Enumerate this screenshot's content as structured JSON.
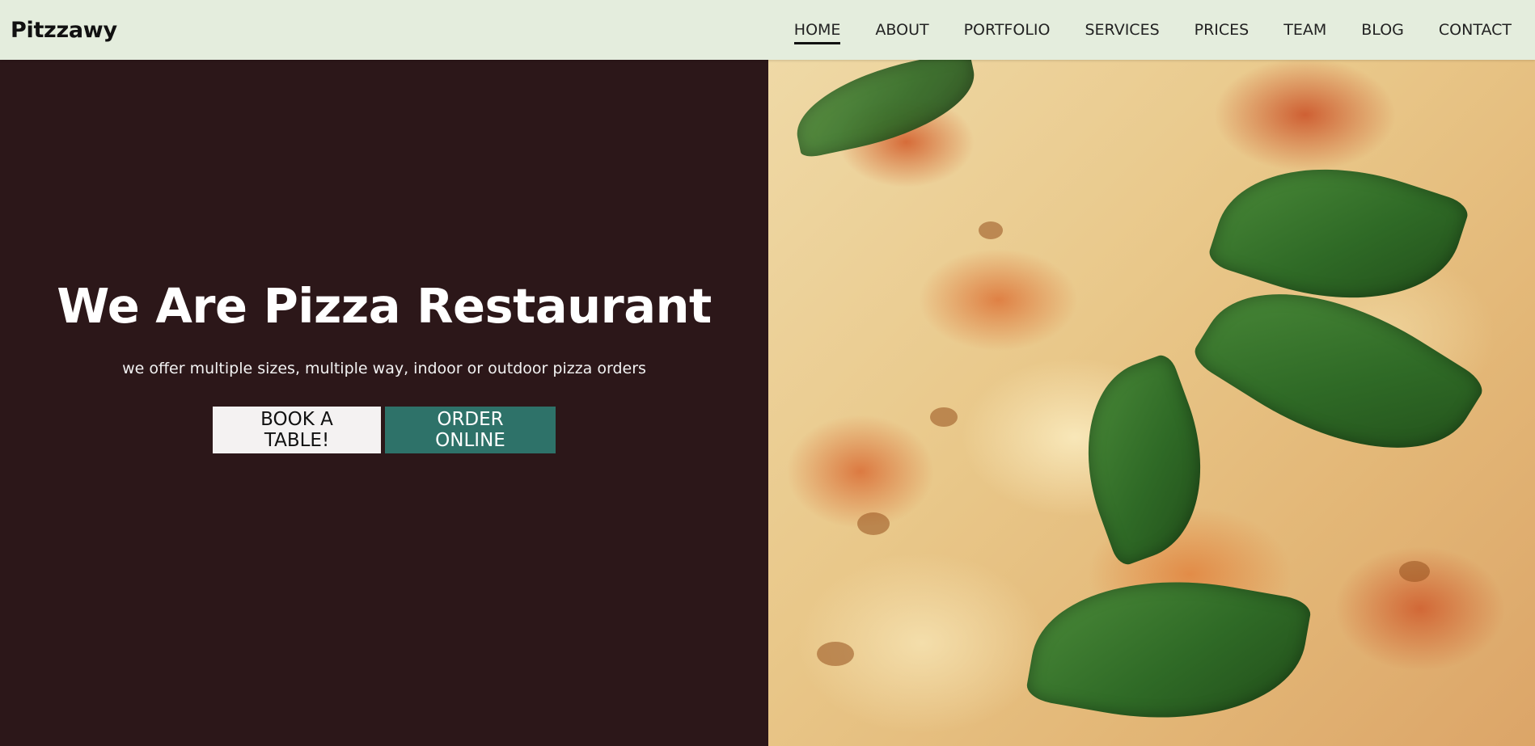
{
  "nav": {
    "brand": "Pitzzawy",
    "links": [
      {
        "label": "HOME",
        "active": true
      },
      {
        "label": "ABOUT",
        "active": false
      },
      {
        "label": "PORTFOLIO",
        "active": false
      },
      {
        "label": "SERVICES",
        "active": false
      },
      {
        "label": "PRICES",
        "active": false
      },
      {
        "label": "TEAM",
        "active": false
      },
      {
        "label": "BLOG",
        "active": false
      },
      {
        "label": "CONTACT",
        "active": false
      }
    ]
  },
  "hero": {
    "title": "We Are Pizza Restaurant",
    "subtitle": "we offer multiple sizes, multiple way, indoor or outdoor pizza orders",
    "book_label": "BOOK A TABLE!",
    "order_label": "ORDER ONLINE",
    "image_subject": "pizza-photo"
  },
  "colors": {
    "navbar_bg": "#e4eddd",
    "hero_bg": "#2c1719",
    "book_button_bg": "#f4f2f2",
    "order_button_bg": "#2e7269"
  }
}
